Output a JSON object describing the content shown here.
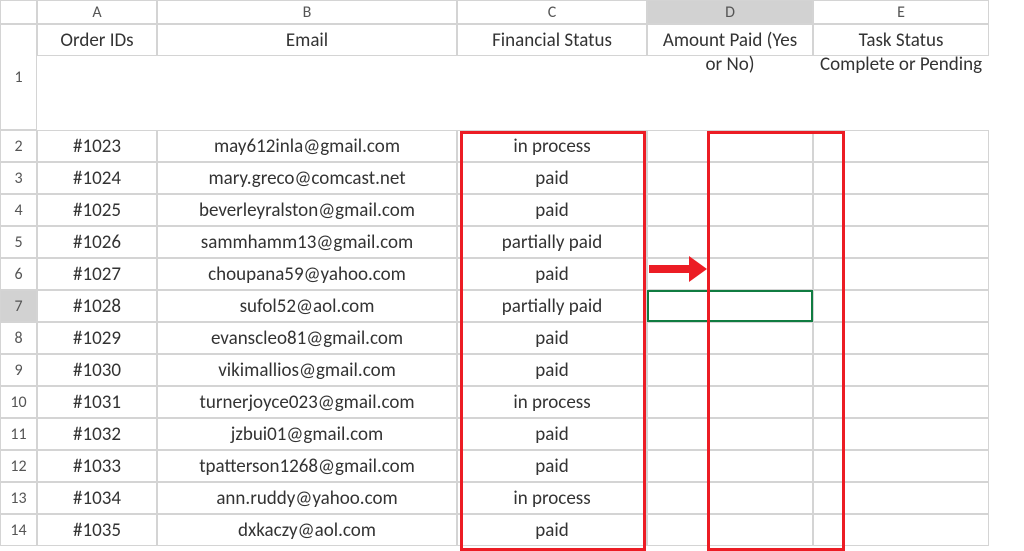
{
  "columns": [
    "A",
    "B",
    "C",
    "D",
    "E"
  ],
  "headers": {
    "A": "Order IDs",
    "B": "Email",
    "C": "Financial Status",
    "D": "Amount Paid (Yes or No)",
    "E": "Task Status Complete or Pending"
  },
  "rows": [
    {
      "n": "2",
      "A": "#1023",
      "B": "may612inla@gmail.com",
      "C": "in process",
      "D": "",
      "E": ""
    },
    {
      "n": "3",
      "A": "#1024",
      "B": "mary.greco@comcast.net",
      "C": "paid",
      "D": "",
      "E": ""
    },
    {
      "n": "4",
      "A": "#1025",
      "B": "beverleyralston@gmail.com",
      "C": "paid",
      "D": "",
      "E": ""
    },
    {
      "n": "5",
      "A": "#1026",
      "B": "sammhamm13@gmail.com",
      "C": "partially paid",
      "D": "",
      "E": ""
    },
    {
      "n": "6",
      "A": "#1027",
      "B": "choupana59@yahoo.com",
      "C": "paid",
      "D": "",
      "E": ""
    },
    {
      "n": "7",
      "A": "#1028",
      "B": "sufol52@aol.com",
      "C": "partially paid",
      "D": "",
      "E": ""
    },
    {
      "n": "8",
      "A": "#1029",
      "B": "evanscleo81@gmail.com",
      "C": "paid",
      "D": "",
      "E": ""
    },
    {
      "n": "9",
      "A": "#1030",
      "B": "vikimallios@gmail.com",
      "C": "paid",
      "D": "",
      "E": ""
    },
    {
      "n": "10",
      "A": "#1031",
      "B": "turnerjoyce023@gmail.com",
      "C": "in process",
      "D": "",
      "E": ""
    },
    {
      "n": "11",
      "A": "#1032",
      "B": "jzbui01@gmail.com",
      "C": "paid",
      "D": "",
      "E": ""
    },
    {
      "n": "12",
      "A": "#1033",
      "B": "tpatterson1268@gmail.com",
      "C": "paid",
      "D": "",
      "E": ""
    },
    {
      "n": "13",
      "A": "#1034",
      "B": "ann.ruddy@yahoo.com",
      "C": "in process",
      "D": "",
      "E": ""
    },
    {
      "n": "14",
      "A": "#1035",
      "B": "dxkaczy@aol.com",
      "C": "paid",
      "D": "",
      "E": ""
    }
  ],
  "selected_column": "D",
  "selected_cell_row": "7"
}
